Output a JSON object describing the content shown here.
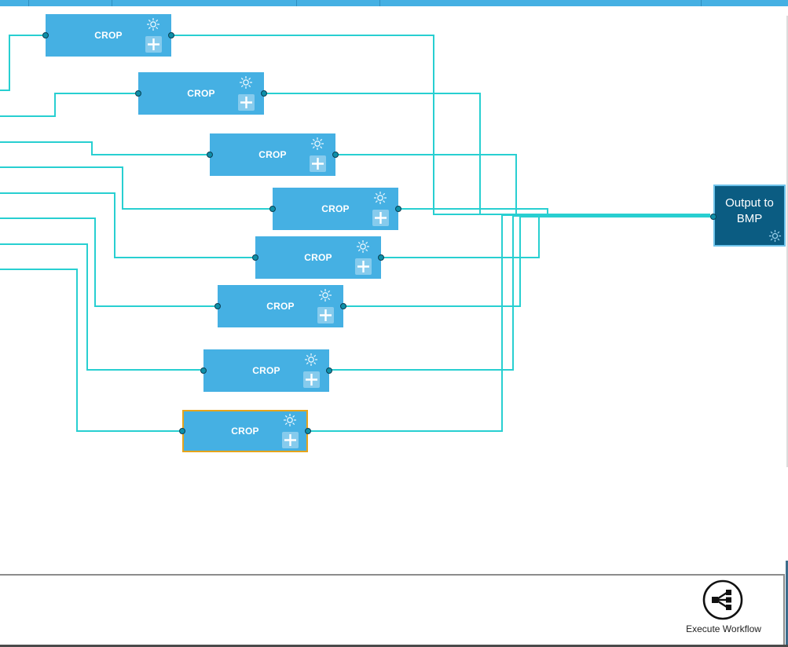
{
  "workflow": {
    "nodes": [
      {
        "id": "crop-1",
        "label": "CROP",
        "selected": false
      },
      {
        "id": "crop-2",
        "label": "CROP",
        "selected": false
      },
      {
        "id": "crop-3",
        "label": "CROP",
        "selected": false
      },
      {
        "id": "crop-4",
        "label": "CROP",
        "selected": false
      },
      {
        "id": "crop-5",
        "label": "CROP",
        "selected": false
      },
      {
        "id": "crop-6",
        "label": "CROP",
        "selected": false
      },
      {
        "id": "crop-7",
        "label": "CROP",
        "selected": false
      },
      {
        "id": "crop-8",
        "label": "CROP",
        "selected": true
      }
    ],
    "output_node": {
      "label": "Output to BMP"
    }
  },
  "toolbar": {
    "execute_label": "Execute Workflow"
  },
  "colors": {
    "node_fill": "#45b0e3",
    "output_fill": "#0b5c82",
    "wire": "#28cfd1",
    "selected_border": "#e5a41c"
  },
  "icons": {
    "node_settings": "gear-icon",
    "node_add": "plus-icon",
    "output_settings": "gear-icon",
    "execute": "workflow-share-icon"
  }
}
